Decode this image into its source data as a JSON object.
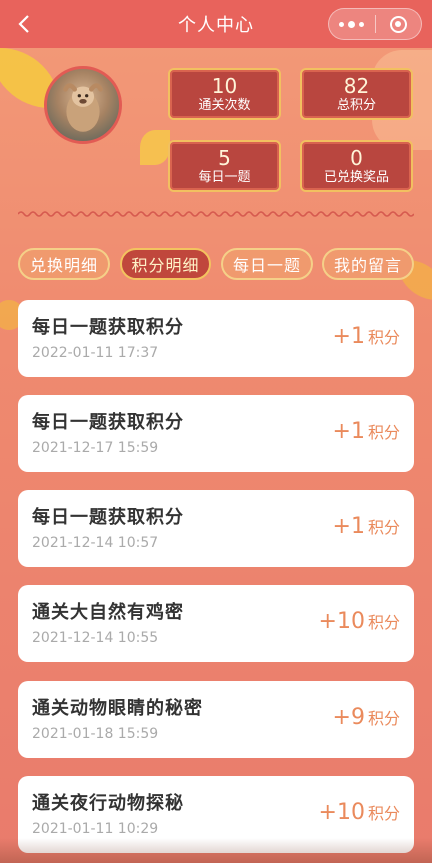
{
  "header": {
    "title": "个人中心"
  },
  "stats": [
    {
      "value": "10",
      "label": "通关次数"
    },
    {
      "value": "82",
      "label": "总积分"
    },
    {
      "value": "5",
      "label": "每日一题"
    },
    {
      "value": "0",
      "label": "已兑换奖品"
    }
  ],
  "tabs": [
    {
      "label": "兑换明细",
      "active": false
    },
    {
      "label": "积分明细",
      "active": true
    },
    {
      "label": "每日一题",
      "active": false
    },
    {
      "label": "我的留言",
      "active": false
    }
  ],
  "records": [
    {
      "title": "每日一题获取积分",
      "time": "2022-01-11 17:37",
      "points": "+1",
      "unit": "积分"
    },
    {
      "title": "每日一题获取积分",
      "time": "2021-12-17 15:59",
      "points": "+1",
      "unit": "积分"
    },
    {
      "title": "每日一题获取积分",
      "time": "2021-12-14 10:57",
      "points": "+1",
      "unit": "积分"
    },
    {
      "title": "通关大自然有鸡密",
      "time": "2021-12-14 10:55",
      "points": "+10",
      "unit": "积分"
    },
    {
      "title": "通关动物眼睛的秘密",
      "time": "2021-01-18 15:59",
      "points": "+9",
      "unit": "积分"
    },
    {
      "title": "通关夜行动物探秘",
      "time": "2021-01-11 10:29",
      "points": "+10",
      "unit": "积分"
    }
  ],
  "colors": {
    "header": "#e8635c",
    "accent": "#ea8a5c",
    "stat_bg": "#b9463f",
    "gold": "#f2c060"
  },
  "icons": {
    "back": "chevron-left-icon",
    "menu": "more-dots-icon",
    "close": "target-close-icon"
  }
}
